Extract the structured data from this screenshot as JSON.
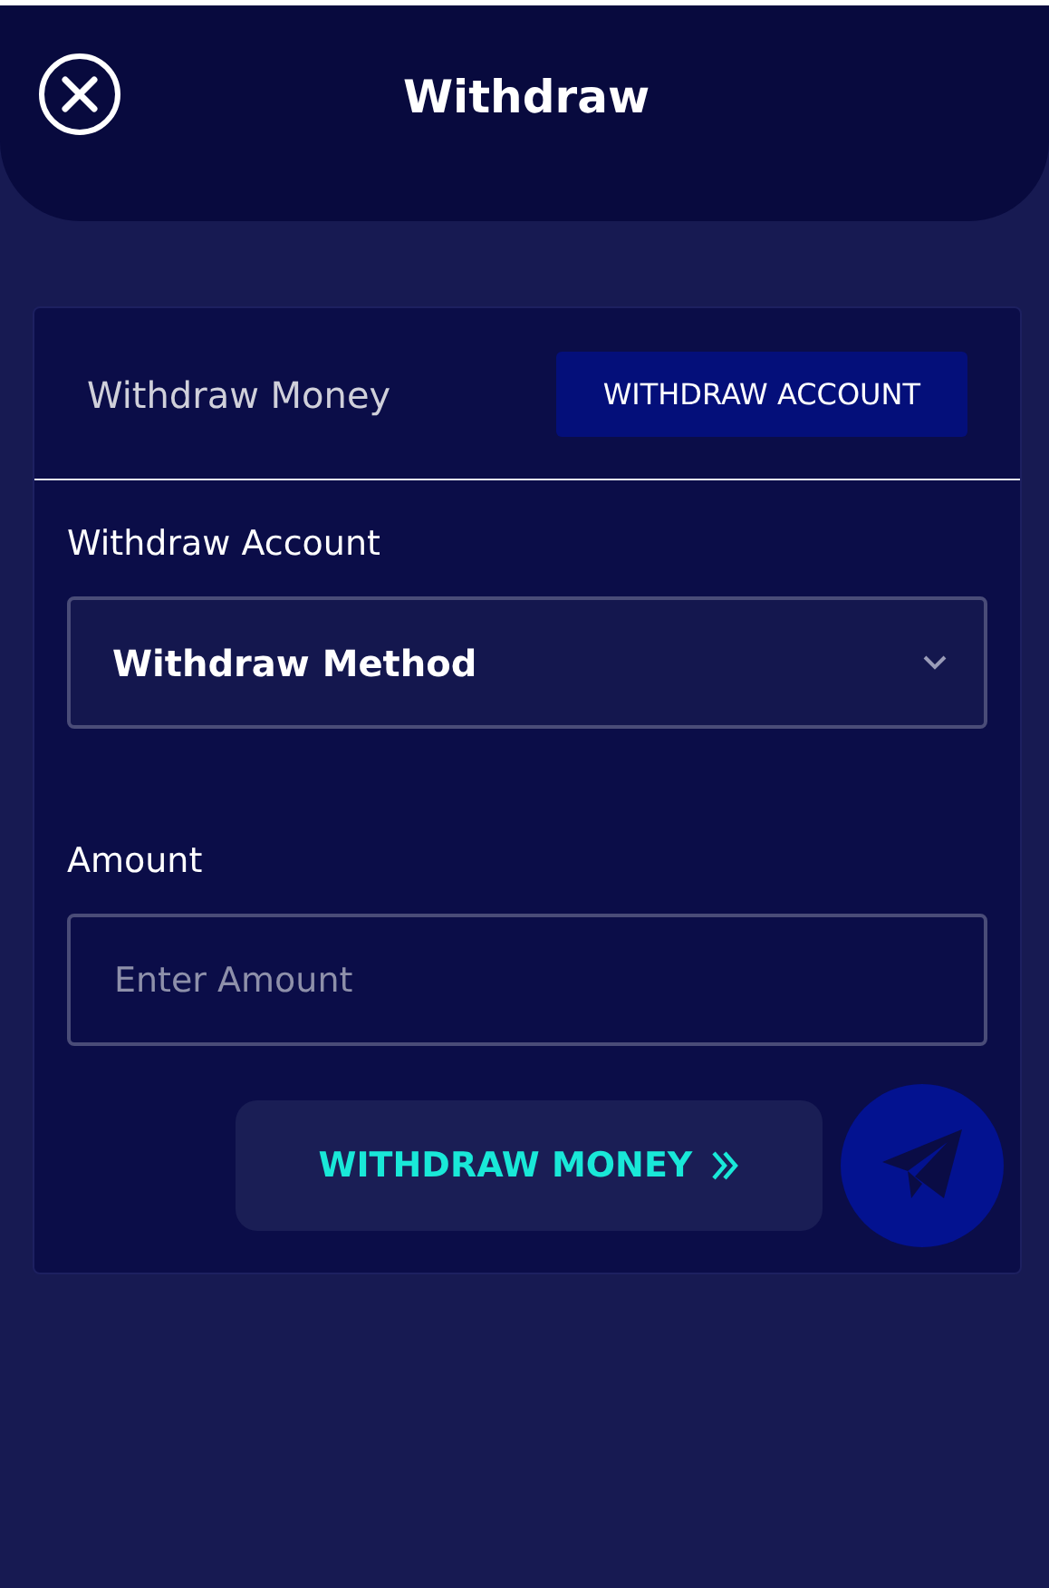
{
  "header": {
    "title": "Withdraw"
  },
  "tabs": [
    {
      "label": "Withdraw Money",
      "selected": false
    },
    {
      "label": "WITHDRAW ACCOUNT",
      "selected": true
    }
  ],
  "account_field": {
    "label": "Withdraw Account",
    "value": "Withdraw Method"
  },
  "amount_field": {
    "label": "Amount",
    "placeholder": "Enter Amount"
  },
  "submit_button": {
    "label": "WITHDRAW MONEY"
  }
}
